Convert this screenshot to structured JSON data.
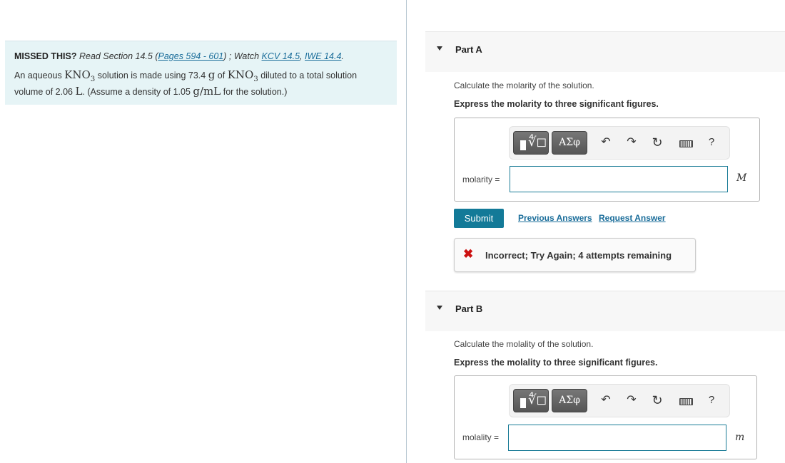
{
  "intro": {
    "missed_label": "MISSED THIS?",
    "read_text": "Read Section 14.5 (",
    "pages_link": "Pages 594 - 601",
    "watch_text": ") ; Watch",
    "kcv_link": "KCV 14.5",
    "iwe_link": "IWE 14.4",
    "problem": {
      "t1": "An aqueous",
      "compound": "KNO",
      "sub": "3",
      "t2": "solution is made using 73.4",
      "mass_unit": "g",
      "t3": "of",
      "t4": "diluted to a total solution",
      "t5": "volume of 2.06",
      "vol_unit": "L",
      "t6": ". (Assume a density of 1.05",
      "density_unit": "g/mL",
      "t7": "for the solution.)"
    }
  },
  "parts": [
    {
      "title": "Part A",
      "prompt": "Calculate the molarity of the solution.",
      "instruction": "Express the molarity to three significant figures.",
      "answer_label": "molarity =",
      "answer_value": "",
      "unit": "M"
    },
    {
      "title": "Part B",
      "prompt": "Calculate the molality of the solution.",
      "instruction": "Express the molality to three significant figures.",
      "answer_label": "molality =",
      "answer_value": "",
      "unit": "m"
    }
  ],
  "toolbar": {
    "templates_icon": "templates-icon",
    "greek_label": "ΑΣφ",
    "undo_glyph": "↶",
    "redo_glyph": "↷",
    "reset_glyph": "↻",
    "help_label": "?"
  },
  "actions": {
    "submit_label": "Submit",
    "previous_answers": "Previous Answers",
    "request_answer": "Request Answer"
  },
  "feedback": {
    "icon": "✖",
    "message": "Incorrect; Try Again; 4 attempts remaining",
    "color": "#cc1111"
  }
}
